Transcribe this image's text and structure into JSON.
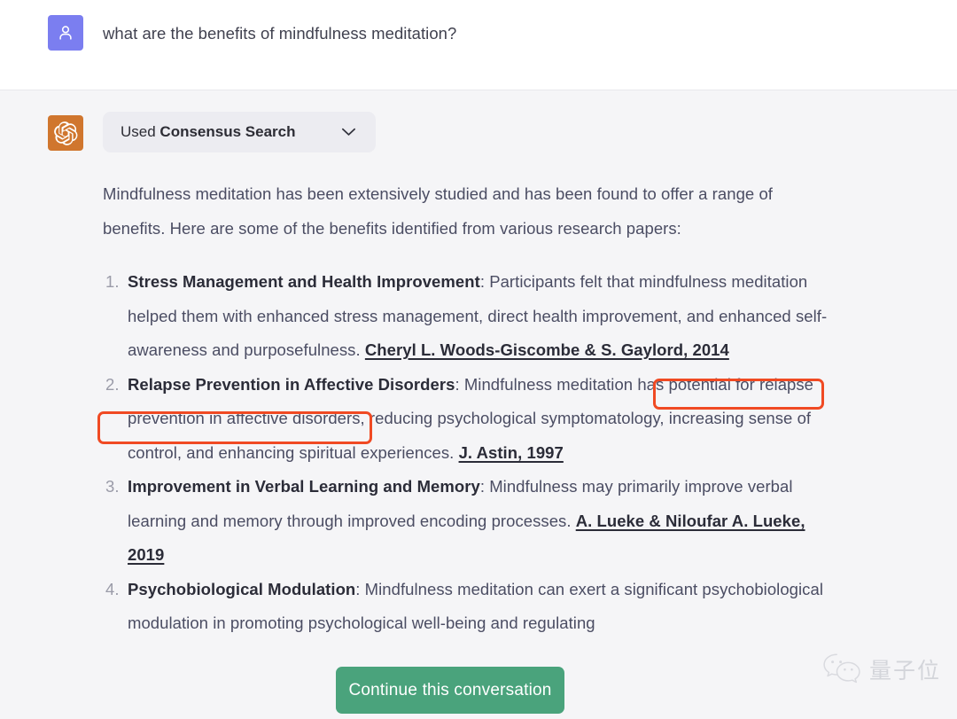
{
  "colors": {
    "user_avatar": "#7b7ef0",
    "assistant_avatar": "#d0762e",
    "annotation_box": "#f04a23",
    "continue_button": "#4aa37c",
    "assistant_background": "#f5f5f7",
    "user_background": "#ffffff"
  },
  "user_turn": {
    "avatar_icon": "person-icon",
    "message": "what are the benefits of mindfulness meditation?"
  },
  "assistant_turn": {
    "avatar_icon": "openai-logo-icon",
    "tool_pill": {
      "prefix": "Used ",
      "tool_name": "Consensus Search",
      "chevron_icon": "chevron-down-icon"
    },
    "intro": "Mindfulness meditation has been extensively studied and has been found to offer a range of benefits. Here are some of the benefits identified from various research papers:",
    "benefits": [
      {
        "number": "1.",
        "title": "Stress Management and Health Improvement",
        "body": ": Participants felt that mindfulness meditation helped them with enhanced stress management, direct health improvement, and enhanced self-awareness and purposefulness. ",
        "citation": "Cheryl L. Woods-Giscombe & S. Gaylord, 2014"
      },
      {
        "number": "2.",
        "title": "Relapse Prevention in Affective Disorders",
        "body": ": Mindfulness meditation has potential for relapse prevention in affective disorders, reducing psychological symptomatology, increasing sense of control, and enhancing spiritual experiences. ",
        "citation": "J. Astin, 1997"
      },
      {
        "number": "3.",
        "title": "Improvement in Verbal Learning and Memory",
        "body": ": Mindfulness may primarily improve verbal learning and memory through improved encoding processes. ",
        "citation": "A. Lueke & Niloufar A. Lueke, 2019"
      },
      {
        "number": "4.",
        "title": "Psychobiological Modulation",
        "body": ": Mindfulness meditation can exert a significant psychobiological modulation in promoting psychological well-being and regulating",
        "citation": ""
      }
    ]
  },
  "continue_button": {
    "label": "Continue this conversation"
  },
  "watermark": {
    "icon": "wechat-icon",
    "text": "量子位"
  },
  "annotations": [
    {
      "name": "annotation-box-citation-part-1"
    },
    {
      "name": "annotation-box-citation-part-2"
    }
  ]
}
